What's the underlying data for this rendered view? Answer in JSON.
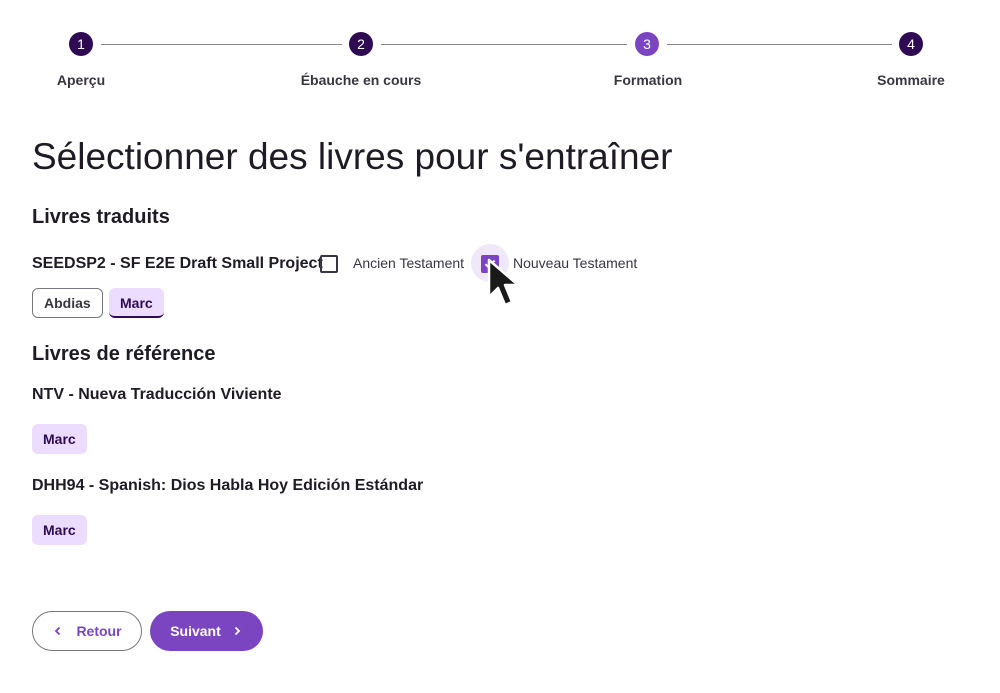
{
  "stepper": {
    "steps": [
      {
        "number": "1",
        "label": "Aperçu"
      },
      {
        "number": "2",
        "label": "Ébauche en cours"
      },
      {
        "number": "3",
        "label": "Formation"
      },
      {
        "number": "4",
        "label": "Sommaire"
      }
    ],
    "active_step": 3
  },
  "page_title": "Sélectionner des livres pour s'entraîner",
  "translated": {
    "heading": "Livres traduits",
    "project_name": "SEEDSP2 - SF E2E Draft Small Project",
    "old_testament_label": "Ancien Testament",
    "old_testament_checked": false,
    "new_testament_label": "Nouveau Testament",
    "new_testament_checked": true,
    "books": [
      {
        "label": "Abdias",
        "selected": false
      },
      {
        "label": "Marc",
        "selected": true
      }
    ]
  },
  "reference": {
    "heading": "Livres de référence",
    "sources": [
      {
        "name": "NTV - Nueva Traducción Viviente",
        "books": [
          "Marc"
        ]
      },
      {
        "name": "DHH94 - Spanish: Dios Habla Hoy Edición Estándar",
        "books": [
          "Marc"
        ]
      }
    ]
  },
  "actions": {
    "back_label": "Retour",
    "next_label": "Suivant"
  },
  "colors": {
    "primary": "#7b45c2",
    "step_dark": "#2e0a52",
    "chip_selected_bg": "#ecdcff"
  },
  "icons": {
    "back": "chevron-left-icon",
    "next": "chevron-right-icon",
    "checkbox": "checkmark-icon",
    "pointer": "mouse-cursor-icon"
  }
}
